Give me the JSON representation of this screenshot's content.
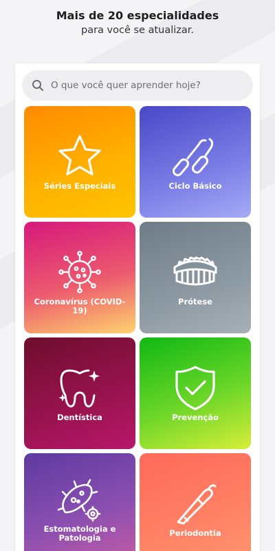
{
  "header": {
    "title": "Mais de 20 especialidades",
    "subtitle": "para você se atualizar."
  },
  "search": {
    "placeholder": "O que você quer aprender hoje?",
    "icon": "search-icon"
  },
  "categories": [
    {
      "label": "Séries Especiais",
      "icon": "star-icon"
    },
    {
      "label": "Ciclo Básico",
      "icon": "dental-instruments-icon"
    },
    {
      "label": "Coronavírus (COVID-19)",
      "icon": "virus-icon"
    },
    {
      "label": "Prótese",
      "icon": "denture-icon"
    },
    {
      "label": "Dentística",
      "icon": "sparkling-tooth-icon"
    },
    {
      "label": "Prevenção",
      "icon": "shield-check-icon"
    },
    {
      "label": "Estomatologia e Patologia",
      "icon": "bacteria-icon"
    },
    {
      "label": "Periodontia",
      "icon": "periodontal-probe-icon"
    }
  ],
  "colors": {
    "background": "#f4f4f6",
    "search_bg": "#eeeef0",
    "card_text": "#ffffff"
  }
}
